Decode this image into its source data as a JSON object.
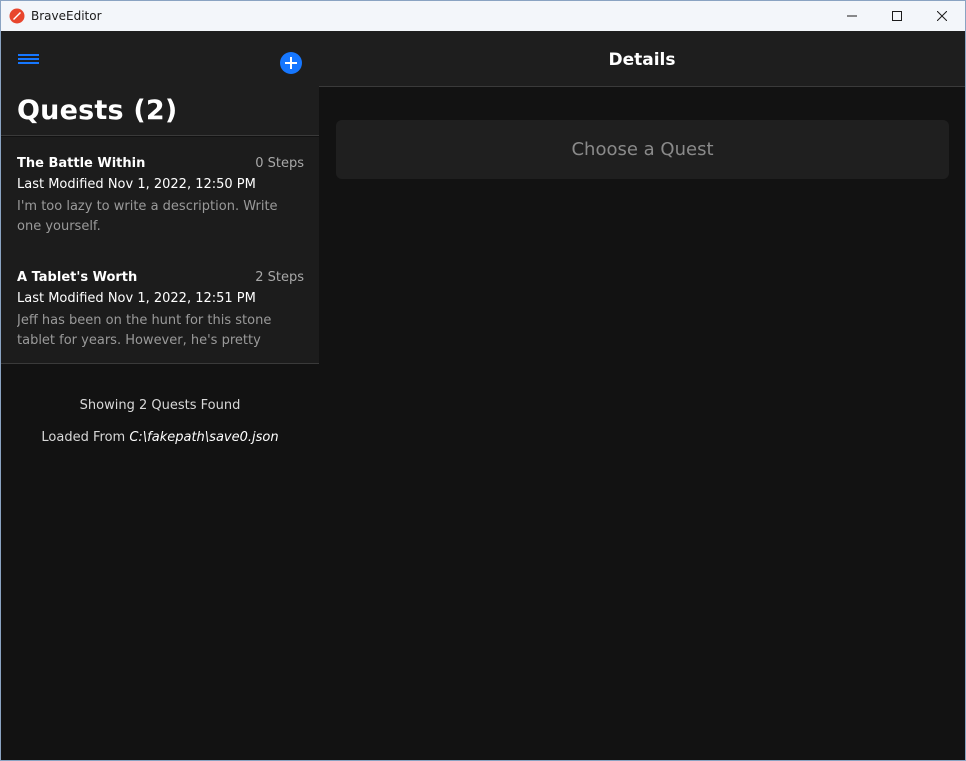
{
  "window": {
    "title": "BraveEditor",
    "accent": "#1677ff"
  },
  "sidebar": {
    "title": "Quests (2)",
    "quests": [
      {
        "name": "The Battle Within",
        "steps": "0 Steps",
        "modified": "Last Modified Nov 1, 2022, 12:50 PM",
        "description": "I'm too lazy to write a description. Write one yourself."
      },
      {
        "name": "A Tablet's Worth",
        "steps": "2 Steps",
        "modified": "Last Modified Nov 1, 2022, 12:51 PM",
        "description": "Jeff has been on the hunt for this stone tablet for years. However, he's pretty stupid so he's..."
      }
    ],
    "status": {
      "found": "Showing 2 Quests Found",
      "loaded_prefix": "Loaded From",
      "loaded_path": "C:\\fakepath\\save0.json"
    },
    "icons": {
      "menu": "hamburger-menu-icon",
      "add": "plus-circle-icon"
    }
  },
  "details": {
    "title": "Details",
    "placeholder": "Choose a Quest"
  }
}
